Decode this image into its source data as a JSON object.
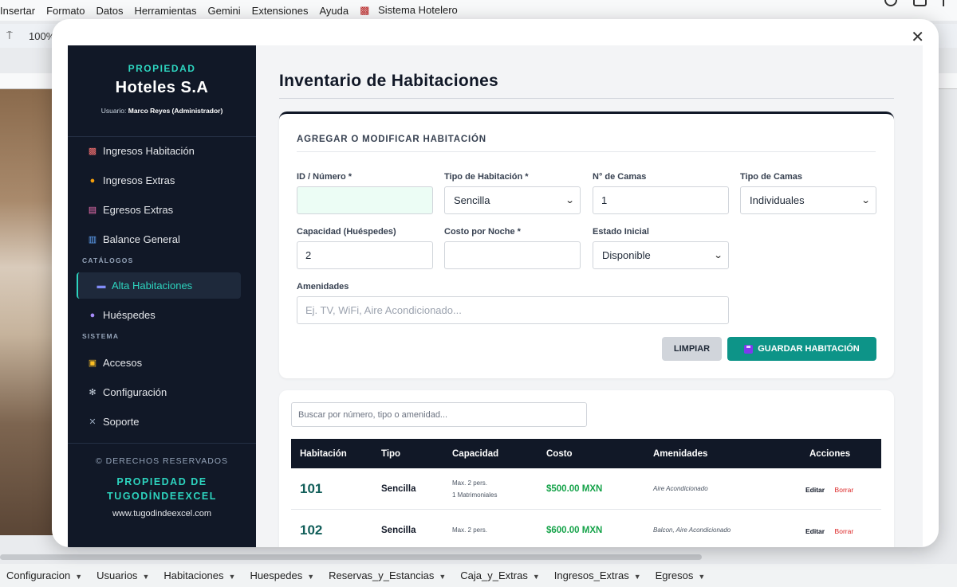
{
  "sheet": {
    "menu": [
      "Insertar",
      "Formato",
      "Datos",
      "Herramientas",
      "Gemini",
      "Extensiones",
      "Ayuda"
    ],
    "menu_extra": "Sistema Hotelero",
    "zoom": "100%",
    "tabs": [
      "Configuracion",
      "Usuarios",
      "Habitaciones",
      "Huespedes",
      "Reservas_y_Estancias",
      "Caja_y_Extras",
      "Ingresos_Extras",
      "Egresos"
    ]
  },
  "sidebar": {
    "kicker": "PROPIEDAD",
    "name": "Hoteles S.A",
    "user_prefix": "Usuario:",
    "user_name": "Marco Reyes (Administrador)",
    "items_main": [
      {
        "label": "Ingresos Habitación",
        "icon": "hotel-icon"
      },
      {
        "label": "Ingresos Extras",
        "icon": "money-bag-icon"
      },
      {
        "label": "Egresos Extras",
        "icon": "chart-down-icon"
      },
      {
        "label": "Balance General",
        "icon": "bar-chart-icon"
      }
    ],
    "section_catalogs": "CATÁLOGOS",
    "items_catalogs": [
      {
        "label": "Alta Habitaciones",
        "icon": "bed-icon"
      },
      {
        "label": "Huéspedes",
        "icon": "users-icon"
      }
    ],
    "section_system": "SISTEMA",
    "items_system": [
      {
        "label": "Accesos",
        "icon": "lock-icon"
      },
      {
        "label": "Configuración",
        "icon": "gear-icon"
      },
      {
        "label": "Soporte",
        "icon": "tools-icon"
      }
    ],
    "footer_copy": "© DERECHOS RESERVADOS",
    "footer_owner_1": "PROPIEDAD DE",
    "footer_owner_2": "TUGODÍNDEEXCEL",
    "footer_web": "www.tugodindeexcel.com"
  },
  "main": {
    "title": "Inventario de Habitaciones",
    "form": {
      "title": "AGREGAR O MODIFICAR HABITACIÓN",
      "id_label": "ID / Número *",
      "id_value": "",
      "type_label": "Tipo de Habitación *",
      "type_value": "Sencilla",
      "beds_label": "N° de Camas",
      "beds_value": "1",
      "bedtype_label": "Tipo de Camas",
      "bedtype_value": "Individuales",
      "capacity_label": "Capacidad (Huéspedes)",
      "capacity_value": "2",
      "cost_label": "Costo por Noche *",
      "cost_value": "",
      "status_label": "Estado Inicial",
      "status_value": "Disponible",
      "amenities_label": "Amenidades",
      "amenities_placeholder": "Ej. TV, WiFi, Aire Acondicionado...",
      "clear_label": "LIMPIAR",
      "save_label": "GUARDAR HABITACIÓN"
    },
    "table": {
      "search_placeholder": "Buscar por número, tipo o amenidad...",
      "headers": [
        "Habitación",
        "Tipo",
        "Capacidad",
        "Costo",
        "Amenidades",
        "Acciones"
      ],
      "rows": [
        {
          "room": "101",
          "type": "Sencilla",
          "cap1": "Max. 2 pers.",
          "cap2": "1 Matrimoniales",
          "cost": "$500.00 MXN",
          "amenities": "Aire Acondicionado",
          "edit": "Editar",
          "delete": "Borrar"
        },
        {
          "room": "102",
          "type": "Sencilla",
          "cap1": "Max. 2 pers.",
          "cap2": "",
          "cost": "$600.00 MXN",
          "amenities": "Balcon, Aire Acondicionado",
          "edit": "Editar",
          "delete": "Borrar"
        }
      ]
    }
  },
  "colors": {
    "sidebar": "#111827",
    "accent": "#2dd4bf",
    "primary": "#0d9488",
    "money": "#16a34a",
    "danger": "#dc2626"
  }
}
